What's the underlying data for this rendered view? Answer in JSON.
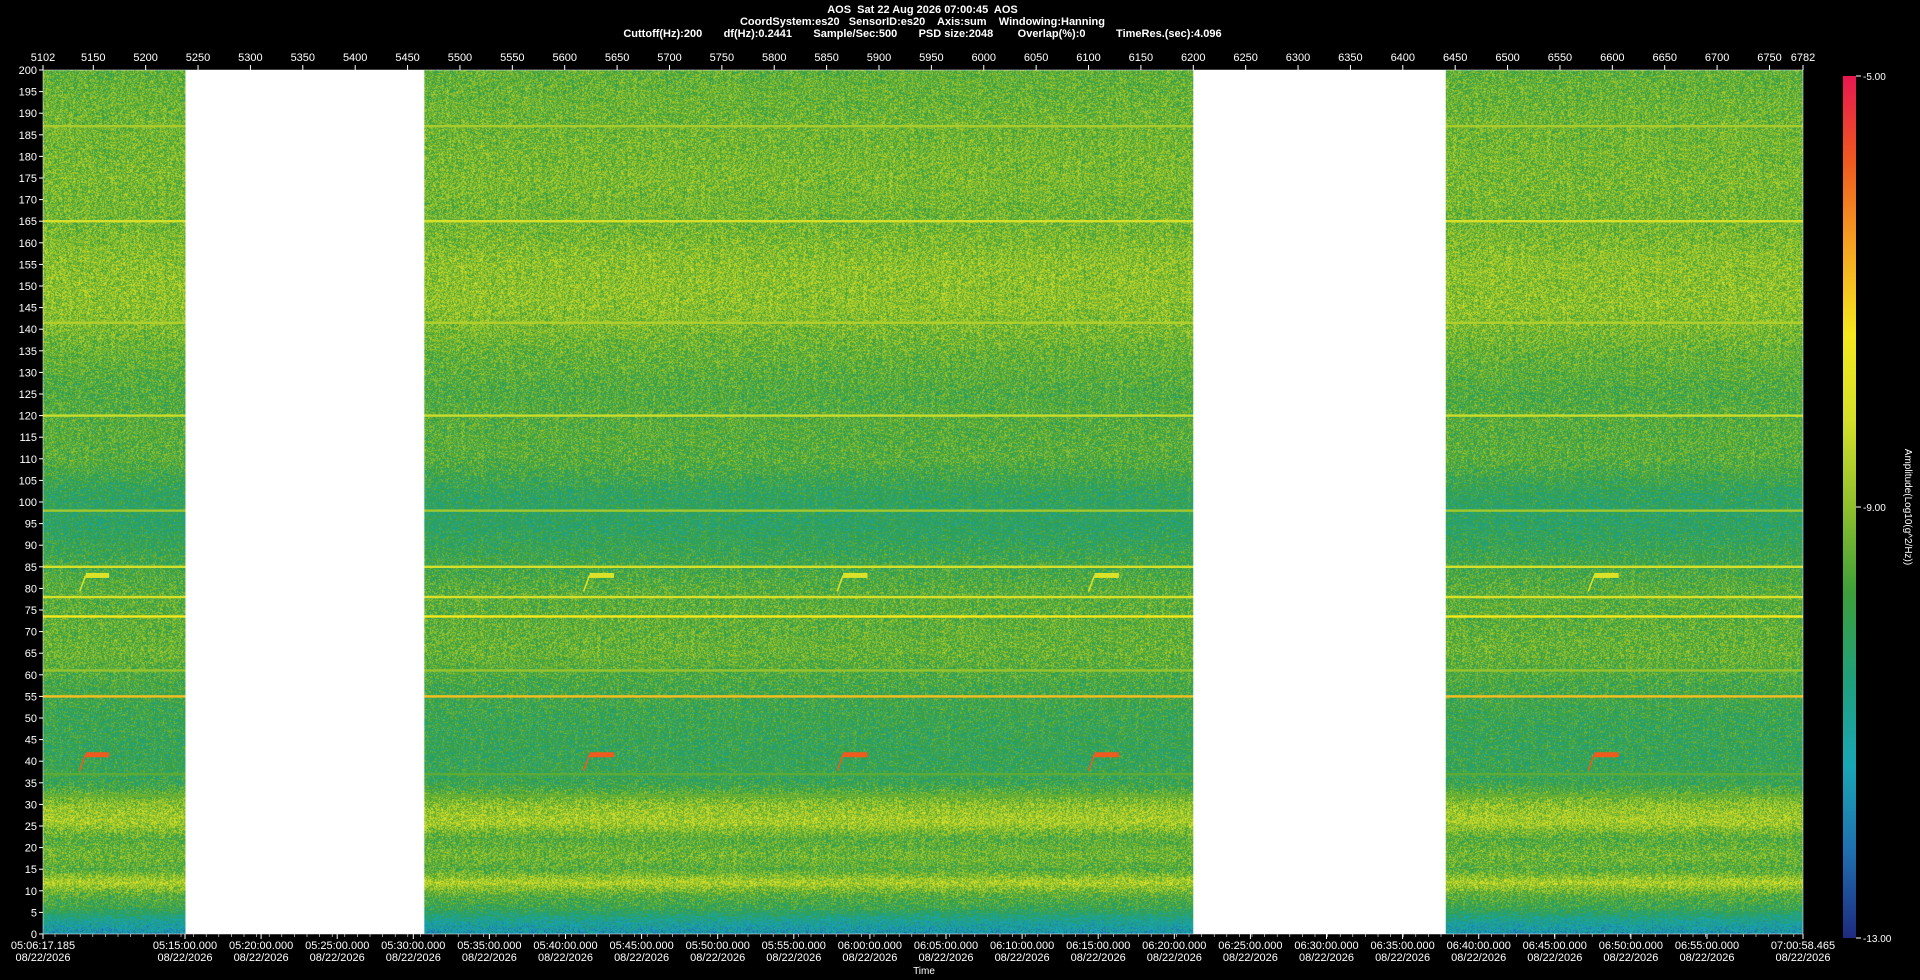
{
  "header": {
    "line1": "AOS  Sat 22 Aug 2026 07:00:45  AOS",
    "line2": "CoordSystem:es20   SensorID:es20    Axis:sum    Windowing:Hanning",
    "line3": "Cuttoff(Hz):200       df(Hz):0.2441       Sample/Sec:500       PSD size:2048        Overlap(%):0          TimeRes.(sec):4.096"
  },
  "colors": {
    "background": "#000000",
    "gap": "#ffffff",
    "colormap": [
      "#1e2a80",
      "#1f6fb0",
      "#19a7b5",
      "#1fa07c",
      "#3d9f3a",
      "#8fbf2c",
      "#d4e02a",
      "#f5e81d",
      "#f7a521",
      "#ef5a1f",
      "#e8174f"
    ]
  },
  "chart_data": {
    "type": "heatmap",
    "title": "AOS  Sat 22 Aug 2026 07:00:45  AOS",
    "xlabel": "Time",
    "ylabel": "",
    "colorbar_label": "Amplitude(Log10(g^2/Hz))",
    "ylim": [
      0,
      200
    ],
    "y_ticks": [
      200,
      195,
      190,
      185,
      180,
      175,
      170,
      165,
      160,
      155,
      150,
      145,
      140,
      135,
      130,
      125,
      120,
      115,
      110,
      105,
      100,
      95,
      90,
      85,
      80,
      75,
      70,
      65,
      60,
      55,
      50,
      45,
      40,
      35,
      30,
      25,
      20,
      15,
      10,
      5,
      0
    ],
    "top_axis": {
      "range": [
        5102,
        6782
      ],
      "ticks": [
        5102,
        5150,
        5200,
        5250,
        5300,
        5350,
        5400,
        5450,
        5500,
        5550,
        5600,
        5650,
        5700,
        5750,
        5800,
        5850,
        5900,
        5950,
        6000,
        6050,
        6100,
        6150,
        6200,
        6250,
        6300,
        6350,
        6400,
        6450,
        6500,
        6550,
        6600,
        6650,
        6700,
        6750,
        6782
      ]
    },
    "time_axis": {
      "ticks": [
        {
          "time": "05:06:17.185",
          "date": "08/22/2026"
        },
        {
          "time": "05:15:00.000",
          "date": "08/22/2026"
        },
        {
          "time": "05:20:00.000",
          "date": "08/22/2026"
        },
        {
          "time": "05:25:00.000",
          "date": "08/22/2026"
        },
        {
          "time": "05:30:00.000",
          "date": "08/22/2026"
        },
        {
          "time": "05:35:00.000",
          "date": "08/22/2026"
        },
        {
          "time": "05:40:00.000",
          "date": "08/22/2026"
        },
        {
          "time": "05:45:00.000",
          "date": "08/22/2026"
        },
        {
          "time": "05:50:00.000",
          "date": "08/22/2026"
        },
        {
          "time": "05:55:00.000",
          "date": "08/22/2026"
        },
        {
          "time": "06:00:00.000",
          "date": "08/22/2026"
        },
        {
          "time": "06:05:00.000",
          "date": "08/22/2026"
        },
        {
          "time": "06:10:00.000",
          "date": "08/22/2026"
        },
        {
          "time": "06:15:00.000",
          "date": "08/22/2026"
        },
        {
          "time": "06:20:00.000",
          "date": "08/22/2026"
        },
        {
          "time": "06:25:00.000",
          "date": "08/22/2026"
        },
        {
          "time": "06:30:00.000",
          "date": "08/22/2026"
        },
        {
          "time": "06:35:00.000",
          "date": "08/22/2026"
        },
        {
          "time": "06:40:00.000",
          "date": "08/22/2026"
        },
        {
          "time": "06:45:00.000",
          "date": "08/22/2026"
        },
        {
          "time": "06:50:00.000",
          "date": "08/22/2026"
        },
        {
          "time": "06:55:00.000",
          "date": "08/22/2026"
        },
        {
          "time": "07:00:58.465",
          "date": "08/22/2026"
        }
      ]
    },
    "colorbar": {
      "range": [
        -13.0,
        -5.0
      ],
      "tick_labels": [
        "-5.00",
        "-9.00",
        "-13.00"
      ],
      "tick_values": [
        -5,
        -9,
        -13
      ]
    },
    "data_segments": [
      {
        "start": 5102,
        "end": 5238
      },
      {
        "start": 5466,
        "end": 6200
      },
      {
        "start": 6441,
        "end": 6782
      }
    ],
    "gap_segments": [
      {
        "start": 5238,
        "end": 5466
      },
      {
        "start": 6200,
        "end": 6441
      }
    ],
    "frequency_profile_hz": [
      {
        "f": 0,
        "level": -11.6
      },
      {
        "f": 3,
        "level": -11.0
      },
      {
        "f": 6,
        "level": -10.0
      },
      {
        "f": 9,
        "level": -9.6
      },
      {
        "f": 12,
        "level": -8.6
      },
      {
        "f": 15,
        "level": -9.6
      },
      {
        "f": 18,
        "level": -9.3
      },
      {
        "f": 22,
        "level": -9.6
      },
      {
        "f": 26,
        "level": -8.7
      },
      {
        "f": 30,
        "level": -9.0
      },
      {
        "f": 35,
        "level": -10.0
      },
      {
        "f": 42,
        "level": -10.1
      },
      {
        "f": 50,
        "level": -10.0
      },
      {
        "f": 58,
        "level": -9.8
      },
      {
        "f": 65,
        "level": -9.4
      },
      {
        "f": 72,
        "level": -9.5
      },
      {
        "f": 80,
        "level": -9.6
      },
      {
        "f": 88,
        "level": -10.0
      },
      {
        "f": 95,
        "level": -10.3
      },
      {
        "f": 102,
        "level": -10.2
      },
      {
        "f": 110,
        "level": -9.6
      },
      {
        "f": 118,
        "level": -9.6
      },
      {
        "f": 125,
        "level": -9.7
      },
      {
        "f": 135,
        "level": -9.4
      },
      {
        "f": 145,
        "level": -9.0
      },
      {
        "f": 155,
        "level": -9.0
      },
      {
        "f": 165,
        "level": -9.3
      },
      {
        "f": 175,
        "level": -9.2
      },
      {
        "f": 185,
        "level": -9.3
      },
      {
        "f": 195,
        "level": -9.4
      },
      {
        "f": 200,
        "level": -9.5
      }
    ],
    "tonal_lines": [
      {
        "f": 187,
        "level": -8.7
      },
      {
        "f": 165,
        "level": -8.2
      },
      {
        "f": 141.5,
        "level": -8.6
      },
      {
        "f": 120,
        "level": -8.3
      },
      {
        "f": 98,
        "level": -8.8
      },
      {
        "f": 85,
        "level": -8.2
      },
      {
        "f": 78,
        "level": -8.1
      },
      {
        "f": 73.5,
        "level": -7.4
      },
      {
        "f": 61,
        "level": -8.9
      },
      {
        "f": 55,
        "level": -6.9
      },
      {
        "f": 37,
        "level": -9.5
      },
      {
        "f": 32,
        "level": -9.4
      }
    ],
    "events": [
      {
        "x_start": 5137,
        "x_end": 5165,
        "f": 41.5,
        "level": -5.8
      },
      {
        "x_start": 5137,
        "x_end": 5165,
        "f": 83,
        "level": -8.0
      },
      {
        "x_start": 5618,
        "x_end": 5647,
        "f": 41.5,
        "level": -5.8
      },
      {
        "x_start": 5618,
        "x_end": 5647,
        "f": 83,
        "level": -8.0
      },
      {
        "x_start": 5860,
        "x_end": 5889,
        "f": 41.5,
        "level": -5.8
      },
      {
        "x_start": 5860,
        "x_end": 5889,
        "f": 83,
        "level": -8.0
      },
      {
        "x_start": 6100,
        "x_end": 6129,
        "f": 41.5,
        "level": -5.8
      },
      {
        "x_start": 6100,
        "x_end": 6129,
        "f": 83,
        "level": -8.0
      },
      {
        "x_start": 6577,
        "x_end": 6606,
        "f": 41.5,
        "level": -5.8
      },
      {
        "x_start": 6577,
        "x_end": 6606,
        "f": 83,
        "level": -8.0
      }
    ]
  }
}
